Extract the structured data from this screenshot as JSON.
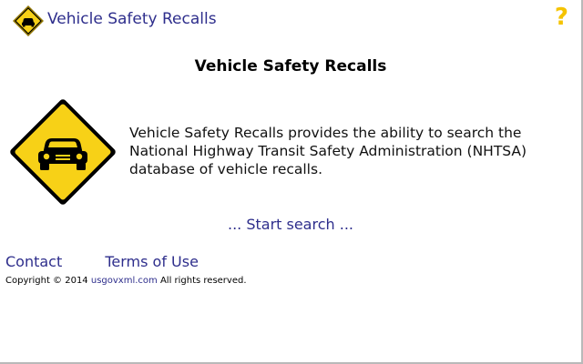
{
  "header": {
    "title": "Vehicle Safety Recalls",
    "logo_icon": "car-warning-sign-icon",
    "help_icon": "help-question-icon",
    "help_glyph": "?"
  },
  "main": {
    "title": "Vehicle Safety Recalls",
    "description": "Vehicle Safety Recalls provides the ability to search the National Highway Transit Safety Administration (NHTSA) database of vehicle recalls.",
    "start_search": "... Start search ...",
    "sign_icon": "car-warning-sign-icon"
  },
  "footer": {
    "contact": "Contact",
    "terms": "Terms of Use",
    "copyright_prefix": "Copyright © 2014 ",
    "copyright_site": "usgovxml.com",
    "copyright_suffix": " All rights reserved."
  },
  "colors": {
    "link": "#2e2e8c",
    "sign_yellow": "#f7d117",
    "sign_border": "#000000",
    "help_yellow": "#f5c300"
  }
}
